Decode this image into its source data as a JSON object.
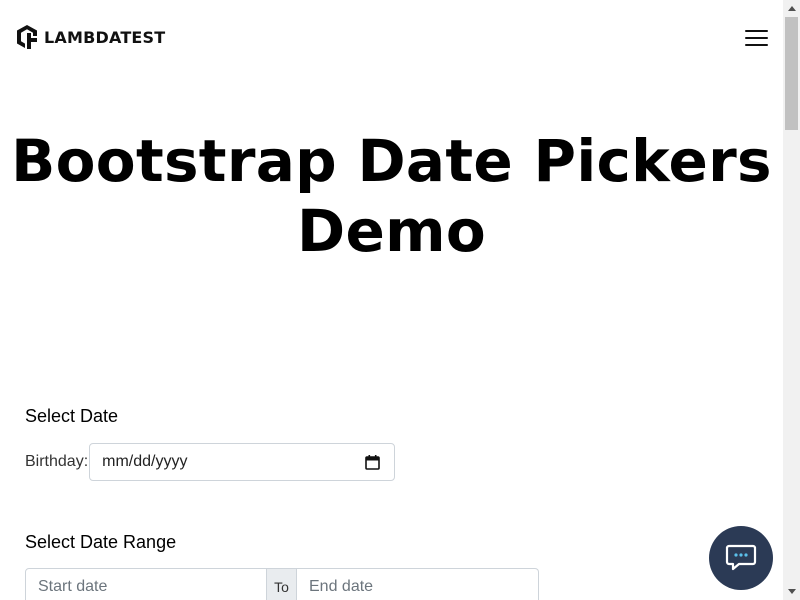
{
  "header": {
    "brand": "LAMBDATEST",
    "logo_icon": "lambdatest-logo-icon",
    "menu_icon": "hamburger-menu-icon"
  },
  "hero": {
    "title_line1": "Bootstrap Date Pickers",
    "title_line2": "Demo"
  },
  "select_date": {
    "heading": "Select Date",
    "birthday_label": "Birthday:",
    "birthday_placeholder": "mm/dd/yyyy",
    "calendar_icon": "calendar-icon"
  },
  "select_range": {
    "heading": "Select Date Range",
    "start_placeholder": "Start date",
    "separator": "To",
    "end_placeholder": "End date"
  },
  "chat": {
    "icon": "chat-bubble-icon",
    "color": "#2b3a55"
  }
}
